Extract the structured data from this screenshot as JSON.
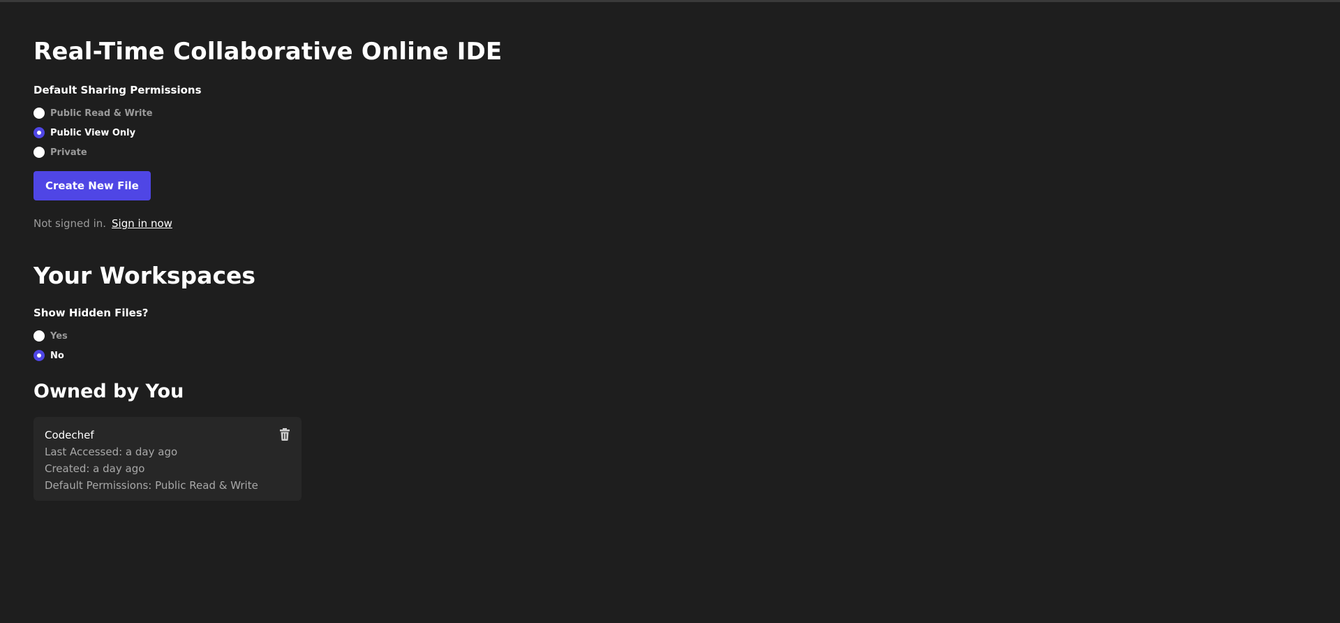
{
  "header": {
    "title": "Real-Time Collaborative Online IDE"
  },
  "sharing": {
    "label": "Default Sharing Permissions",
    "options": [
      {
        "label": "Public Read & Write",
        "selected": false
      },
      {
        "label": "Public View Only",
        "selected": true
      },
      {
        "label": "Private",
        "selected": false
      }
    ]
  },
  "actions": {
    "create_label": "Create New File"
  },
  "auth": {
    "status": "Not signed in.",
    "sign_in_link": "Sign in now"
  },
  "workspaces": {
    "title": "Your Workspaces",
    "hidden_label": "Show Hidden Files?",
    "hidden_options": [
      {
        "label": "Yes",
        "selected": false
      },
      {
        "label": "No",
        "selected": true
      }
    ],
    "owned_title": "Owned by You",
    "files": [
      {
        "name": "Codechef",
        "last_accessed": "Last Accessed: a day ago",
        "created": "Created: a day ago",
        "permissions": "Default Permissions: Public Read & Write"
      }
    ]
  },
  "icons": {
    "delete": "trash-icon"
  },
  "colors": {
    "background": "#1e1e1e",
    "accent": "#4f46e5",
    "card": "#272727",
    "muted_text": "#9a9a9a"
  }
}
